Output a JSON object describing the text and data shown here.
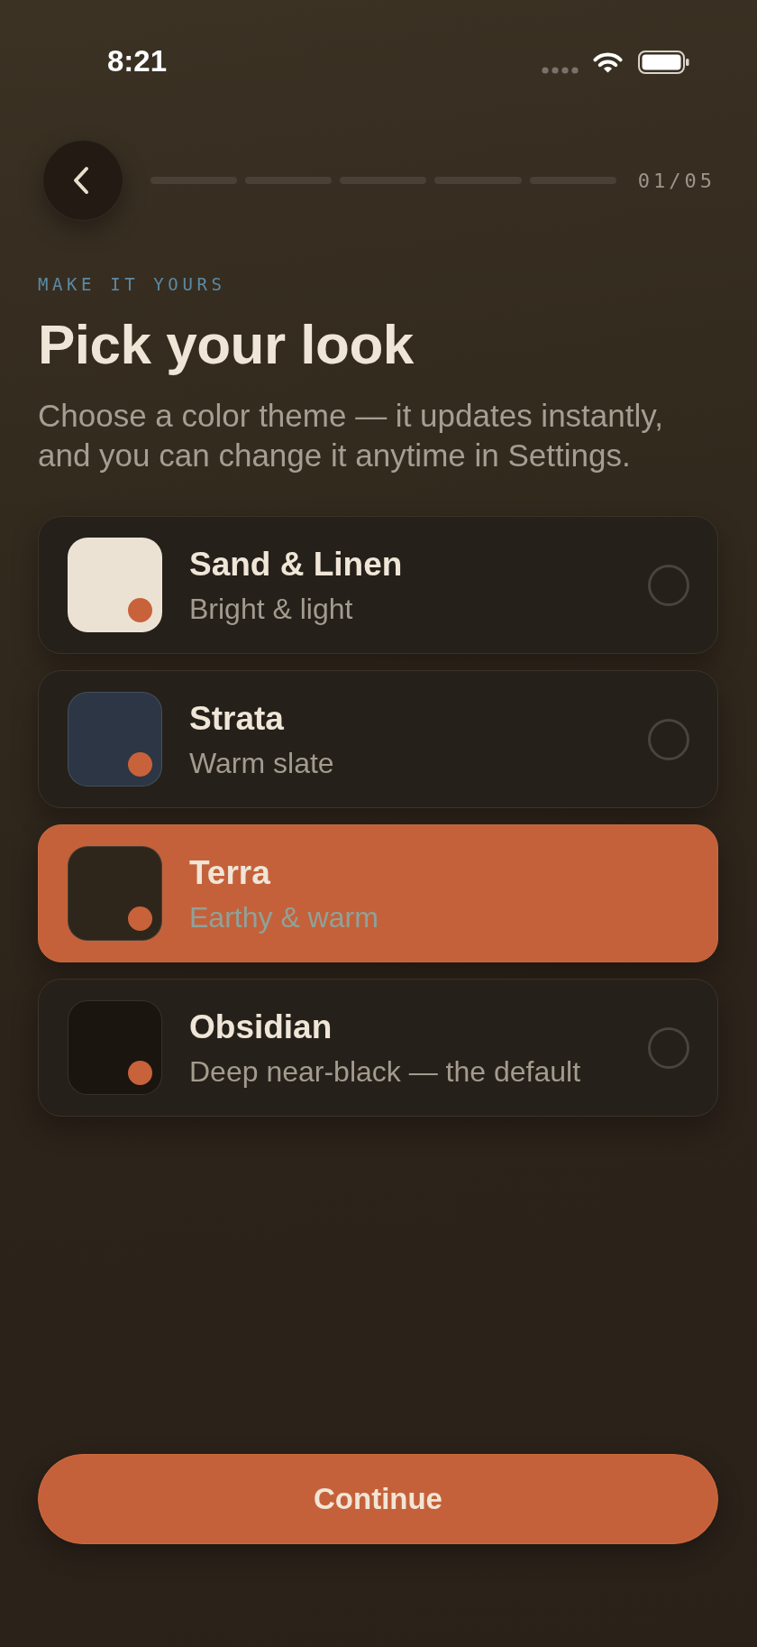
{
  "status_bar": {
    "time": "8:21"
  },
  "progress": {
    "segments": [
      {
        "filled": false
      },
      {
        "filled": false
      },
      {
        "filled": false
      },
      {
        "filled": false
      },
      {
        "filled": false
      }
    ],
    "counter": "01/05"
  },
  "eyebrow": "MAKE IT YOURS",
  "title": "Pick your look",
  "subtitle": "Choose a color theme — it updates instantly, and you can change it anytime in Settings.",
  "themes": [
    {
      "name": "Sand & Linen",
      "description": "Bright & light",
      "color": "#ebe2d4",
      "selected": false
    },
    {
      "name": "Strata",
      "description": "Warm slate",
      "color": "#2d3645",
      "selected": false
    },
    {
      "name": "Terra",
      "description": "Earthy & warm",
      "color": "#2e261b",
      "selected": true
    },
    {
      "name": "Obsidian",
      "description": "Deep near-black — the default",
      "color": "#1b1510",
      "selected": false
    }
  ],
  "continue_button": {
    "label": "Continue"
  }
}
